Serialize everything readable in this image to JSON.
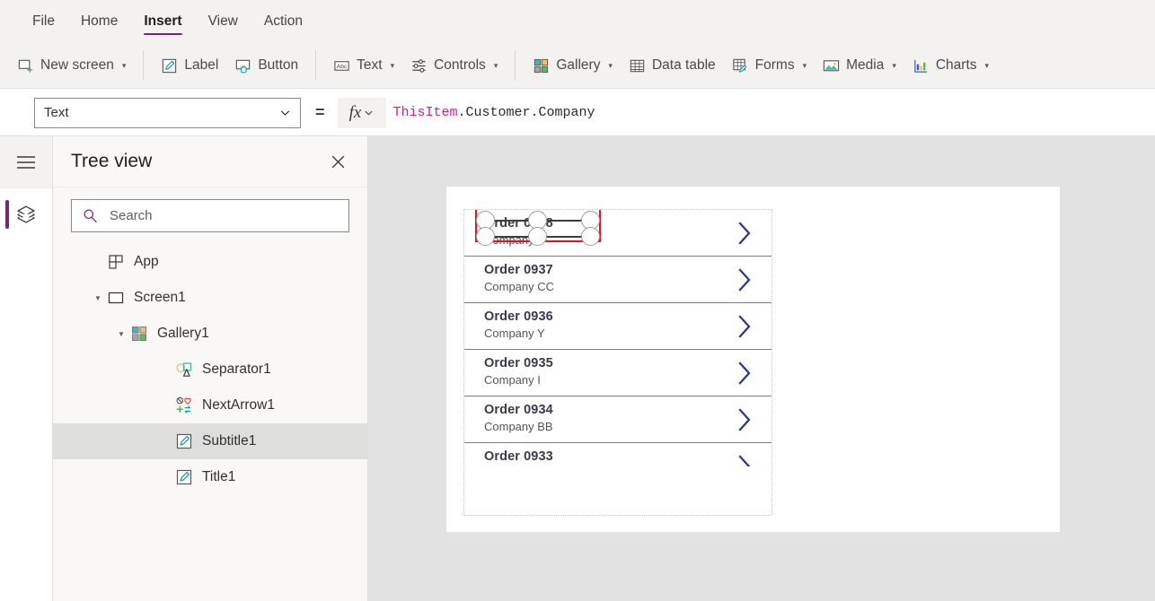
{
  "menu": {
    "items": [
      {
        "label": "File",
        "active": false
      },
      {
        "label": "Home",
        "active": false
      },
      {
        "label": "Insert",
        "active": true
      },
      {
        "label": "View",
        "active": false
      },
      {
        "label": "Action",
        "active": false
      }
    ]
  },
  "ribbon": {
    "groups": [
      {
        "items": [
          {
            "label": "New screen",
            "icon": "new-screen-icon",
            "caret": true
          }
        ]
      },
      {
        "items": [
          {
            "label": "Label",
            "icon": "label-icon",
            "caret": false
          },
          {
            "label": "Button",
            "icon": "button-icon",
            "caret": false
          }
        ]
      },
      {
        "items": [
          {
            "label": "Text",
            "icon": "text-abc-icon",
            "caret": true
          },
          {
            "label": "Controls",
            "icon": "controls-sliders-icon",
            "caret": true
          }
        ]
      },
      {
        "items": [
          {
            "label": "Gallery",
            "icon": "gallery-icon",
            "caret": true
          },
          {
            "label": "Data table",
            "icon": "data-table-icon",
            "caret": false
          },
          {
            "label": "Forms",
            "icon": "forms-icon",
            "caret": true
          },
          {
            "label": "Media",
            "icon": "media-image-icon",
            "caret": true
          },
          {
            "label": "Charts",
            "icon": "charts-icon",
            "caret": true
          }
        ]
      }
    ]
  },
  "formula_bar": {
    "property": "Text",
    "equals": "=",
    "fx_label": "fx",
    "formula_token": "ThisItem",
    "formula_rest": ".Customer.Company"
  },
  "rail": {
    "menu_icon": "hamburger-menu-icon",
    "tree_view_icon": "layers-icon"
  },
  "tree_panel": {
    "title": "Tree view",
    "close_icon": "close-icon",
    "search": {
      "placeholder": "Search",
      "value": "",
      "icon": "search-icon"
    },
    "items": [
      {
        "label": "App",
        "icon": "app-icon",
        "indent": 0,
        "twisty": "",
        "selected": false
      },
      {
        "label": "Screen1",
        "icon": "screen-icon",
        "indent": 0,
        "twisty": "expanded",
        "selected": false
      },
      {
        "label": "Gallery1",
        "icon": "gallery-icon",
        "indent": 1,
        "twisty": "expanded",
        "selected": false
      },
      {
        "label": "Separator1",
        "icon": "shapes-icon",
        "indent": 2,
        "twisty": "",
        "selected": false
      },
      {
        "label": "NextArrow1",
        "icon": "icons-icon",
        "indent": 2,
        "twisty": "",
        "selected": false
      },
      {
        "label": "Subtitle1",
        "icon": "label-icon",
        "indent": 2,
        "twisty": "",
        "selected": true
      },
      {
        "label": "Title1",
        "icon": "label-icon",
        "indent": 2,
        "twisty": "",
        "selected": false
      }
    ]
  },
  "canvas": {
    "gallery_rows": [
      {
        "title": "Order 0938",
        "subtitle": "Company F",
        "chevron": "chevron-right-icon",
        "selected": true,
        "clipped": false
      },
      {
        "title": "Order 0937",
        "subtitle": "Company CC",
        "chevron": "chevron-right-icon",
        "selected": false,
        "clipped": false
      },
      {
        "title": "Order 0936",
        "subtitle": "Company Y",
        "chevron": "chevron-right-icon",
        "selected": false,
        "clipped": false
      },
      {
        "title": "Order 0935",
        "subtitle": "Company I",
        "chevron": "chevron-right-icon",
        "selected": false,
        "clipped": false
      },
      {
        "title": "Order 0934",
        "subtitle": "Company BB",
        "chevron": "chevron-right-icon",
        "selected": false,
        "clipped": false
      },
      {
        "title": "Order 0933",
        "subtitle": "",
        "chevron": "chevron-right-icon",
        "selected": false,
        "clipped": true
      }
    ]
  },
  "colors": {
    "accent": "#742774",
    "selection_red": "#e81123",
    "chevron_blue": "#2b3a8c",
    "separator_blue": "#6a7ba8",
    "ribbon_bg": "#f3f2f1",
    "canvas_bg": "#e2e2e2"
  }
}
